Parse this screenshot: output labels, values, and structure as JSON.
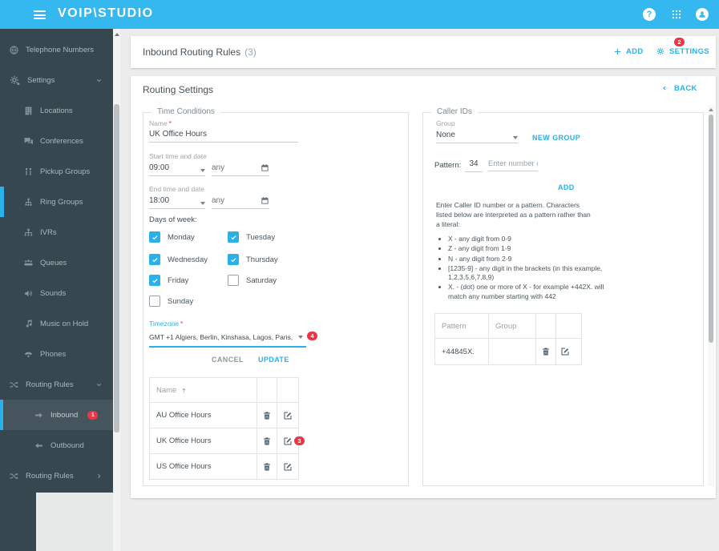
{
  "colors": {
    "accent_blue": "#2bb1e9",
    "topbar_blue": "#35b8ef",
    "sidebar_bg": "#37474f",
    "sidebar_active_bg": "#46545e",
    "badge_red": "#ef3543",
    "text_dark": "#47525a",
    "text_gray": "#9aa3a9"
  },
  "topbar": {
    "logo": "VOIP\\STUDIO",
    "help_glyph": "?"
  },
  "sidebar": {
    "items": [
      {
        "label": "Telephone Numbers",
        "icon": "globe"
      },
      {
        "label": "Settings",
        "icon": "gears",
        "chevron": "down"
      },
      {
        "label": "Locations",
        "icon": "building"
      },
      {
        "label": "Conferences",
        "icon": "chat-bubbles"
      },
      {
        "label": "Pickup Groups",
        "icon": "pickup"
      },
      {
        "label": "Ring Groups",
        "icon": "org-tree"
      },
      {
        "label": "IVRs",
        "icon": "ivr-tree"
      },
      {
        "label": "Queues",
        "icon": "people"
      },
      {
        "label": "Sounds",
        "icon": "speaker"
      },
      {
        "label": "Music on Hold",
        "icon": "music-note"
      },
      {
        "label": "Phones",
        "icon": "phone"
      },
      {
        "label": "Routing Rules",
        "icon": "shuffle",
        "chevron": "down"
      },
      {
        "label": "Inbound",
        "icon": "arrow-right",
        "active": true,
        "badge": "1"
      },
      {
        "label": "Outbound",
        "icon": "arrow-left"
      },
      {
        "label": "Routing Rules",
        "icon": "shuffle",
        "chevron": "right"
      }
    ]
  },
  "page": {
    "title": "Inbound Routing Rules",
    "title_count": "(3)",
    "add_label": "ADD",
    "settings_label": "SETTINGS",
    "settings_badge": "2",
    "subtitle": "Routing Settings",
    "back_label": "BACK"
  },
  "time_conditions": {
    "legend": "Time Conditions",
    "name": {
      "label": "Name",
      "required": "*",
      "value": "UK Office Hours"
    },
    "start": {
      "label": "Start time and date",
      "time": "09:00",
      "date": "any"
    },
    "end": {
      "label": "End time and date",
      "time": "18:00",
      "date": "any"
    },
    "days_label": "Days of week:",
    "days": [
      {
        "label": "Monday",
        "checked": true
      },
      {
        "label": "Tuesday",
        "checked": true
      },
      {
        "label": "Wednesday",
        "checked": true
      },
      {
        "label": "Thursday",
        "checked": true
      },
      {
        "label": "Friday",
        "checked": true
      },
      {
        "label": "Saturday",
        "checked": false
      },
      {
        "label": "Sunday",
        "checked": false
      }
    ],
    "timezone": {
      "label": "Timezone",
      "required": "*",
      "value": "GMT +1 Algiers, Berlin, Kinshasa, Lagos, Paris,",
      "badge": "4"
    },
    "cancel_label": "CANCEL",
    "update_label": "UPDATE",
    "table": {
      "name_header": "Name",
      "rows": [
        {
          "name": "AU Office Hours"
        },
        {
          "name": "UK Office Hours",
          "badge": "3"
        },
        {
          "name": "US Office Hours"
        }
      ]
    }
  },
  "caller_ids": {
    "legend": "Caller IDs",
    "group": {
      "label": "Group",
      "value": "None",
      "new_group_label": "NEW GROUP"
    },
    "pattern": {
      "label": "Pattern:",
      "prefix": "34",
      "placeholder": "Enter number or p"
    },
    "add_label": "ADD",
    "description": "Enter Caller ID number or a pattern. Characters listed below are interpreted as a pattern rather than a literal:",
    "rules": [
      "X - any digit from 0-9",
      "Z - any digit from 1-9",
      "N - any digit from 2-9",
      "[1235-9] - any digit in the brackets (in this example, 1,2,3,5,6,7,8,9)",
      "X. - (dot) one or more of X - for example +442X. will match any number starting with 442"
    ],
    "table": {
      "pattern_header": "Pattern",
      "group_header": "Group",
      "rows": [
        {
          "pattern": "+44845X.",
          "group": ""
        }
      ]
    }
  }
}
